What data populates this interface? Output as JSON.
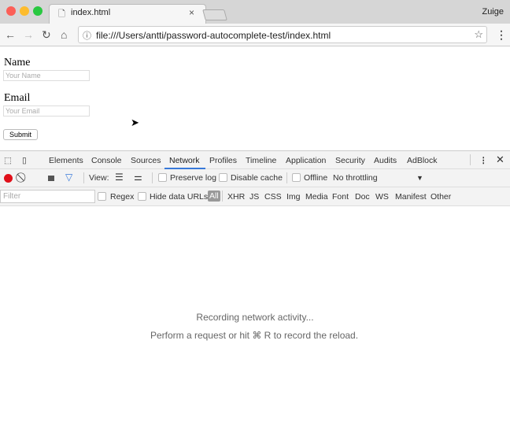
{
  "browser": {
    "tab_title": "index.html",
    "profile": "Zuige",
    "url": "file:///Users/antti/password-autocomplete-test/index.html"
  },
  "page": {
    "name_label": "Name",
    "name_placeholder": "Your Name",
    "email_label": "Email",
    "email_placeholder": "Your Email",
    "submit_label": "Submit"
  },
  "devtools": {
    "tabs": [
      "Elements",
      "Console",
      "Sources",
      "Network",
      "Profiles",
      "Timeline",
      "Application",
      "Security",
      "Audits",
      "AdBlock"
    ],
    "active_tab": "Network",
    "toolbar": {
      "view_label": "View:",
      "preserve_log": "Preserve log",
      "disable_cache": "Disable cache",
      "offline": "Offline",
      "throttling": "No throttling"
    },
    "filter": {
      "placeholder": "Filter",
      "regex": "Regex",
      "hide_data_urls": "Hide data URLs",
      "types": [
        "All",
        "XHR",
        "JS",
        "CSS",
        "Img",
        "Media",
        "Font",
        "Doc",
        "WS",
        "Manifest",
        "Other"
      ]
    },
    "empty": {
      "line1": "Recording network activity...",
      "line2": "Perform a request or hit ⌘ R to record the reload."
    },
    "record_color": "#e0101a",
    "accent": "#3879d9"
  }
}
